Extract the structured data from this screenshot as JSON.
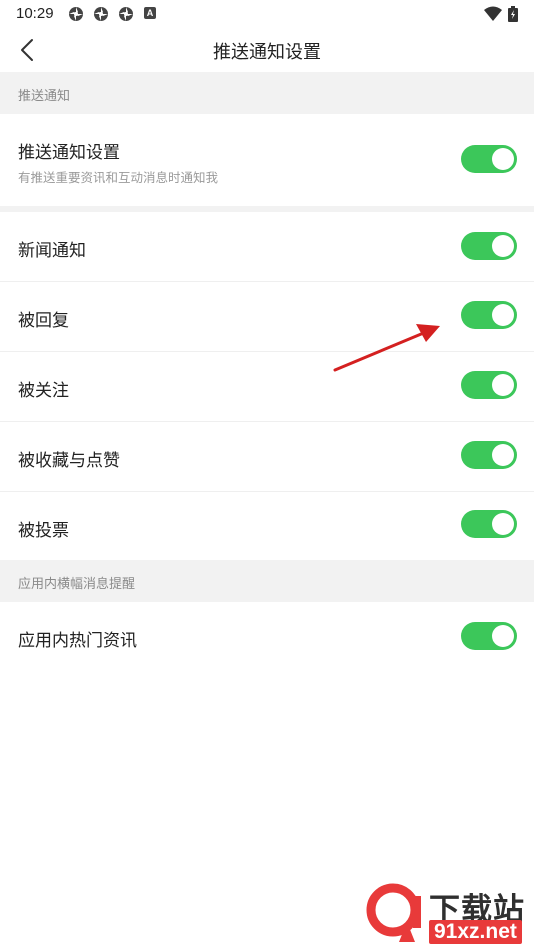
{
  "status_bar": {
    "time": "10:29",
    "icons": [
      "pinwheel-icon",
      "pinwheel-icon",
      "pinwheel-icon",
      "a-badge-icon",
      "wifi-icon",
      "battery-icon"
    ],
    "badge_letter": "A"
  },
  "nav": {
    "title": "推送通知设置",
    "back_icon": "chevron-left-icon"
  },
  "sections": {
    "push": {
      "header": "推送通知"
    },
    "banner": {
      "header": "应用内横幅消息提醒"
    }
  },
  "settings": {
    "master": {
      "label": "推送通知设置",
      "subtitle": "有推送重要资讯和互动消息时通知我",
      "on": true
    },
    "news": {
      "label": "新闻通知",
      "on": true
    },
    "reply": {
      "label": "被回复",
      "on": true
    },
    "follow": {
      "label": "被关注",
      "on": true
    },
    "collect_like": {
      "label": "被收藏与点赞",
      "on": true
    },
    "vote": {
      "label": "被投票",
      "on": true
    },
    "hot_news": {
      "label": "应用内热门资讯",
      "on": true
    }
  },
  "colors": {
    "toggle_on": "#3cc75a",
    "section_bg": "#f2f2f2",
    "annotation_arrow": "#d42020"
  },
  "watermark": {
    "title": "下载站",
    "url": "91xz.net"
  }
}
